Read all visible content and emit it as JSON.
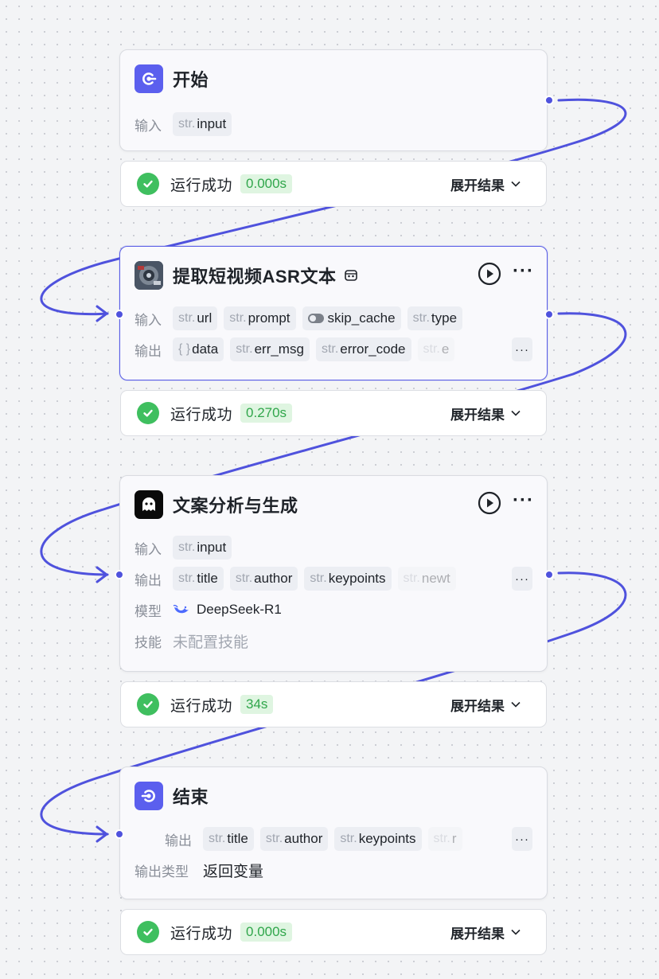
{
  "colors": {
    "edge": "#4f52dd",
    "accent": "#5b5fee",
    "success": "#3fbf5f"
  },
  "labels": {
    "input": "输入",
    "output": "输出",
    "model": "模型",
    "skill": "技能",
    "output_type": "输出类型",
    "type_prefix": "str.",
    "obj_prefix": "{ }"
  },
  "nodes": {
    "start": {
      "title": "开始",
      "icon": "start-icon",
      "inputs": [
        {
          "type": "str.",
          "name": "input"
        }
      ]
    },
    "asr": {
      "title": "提取短视频ASR文本",
      "icon": "plugin-thumbnail-icon",
      "inputs": [
        {
          "type": "str.",
          "name": "url"
        },
        {
          "type": "str.",
          "name": "prompt"
        },
        {
          "type": "toggle",
          "name": "skip_cache"
        },
        {
          "type": "str.",
          "name": "type"
        }
      ],
      "outputs": [
        {
          "type": "{ }",
          "name": "data"
        },
        {
          "type": "str.",
          "name": "err_msg"
        },
        {
          "type": "str.",
          "name": "error_code"
        },
        {
          "type": "str.",
          "name": "e"
        }
      ],
      "more": "···"
    },
    "llm": {
      "title": "文案分析与生成",
      "icon": "llm-bot-icon",
      "inputs": [
        {
          "type": "str.",
          "name": "input"
        }
      ],
      "outputs": [
        {
          "type": "str.",
          "name": "title"
        },
        {
          "type": "str.",
          "name": "author"
        },
        {
          "type": "str.",
          "name": "keypoints"
        },
        {
          "type": "str.",
          "name": "newt"
        }
      ],
      "model": "DeepSeek-R1",
      "skill": "未配置技能",
      "more": "···"
    },
    "end": {
      "title": "结束",
      "icon": "end-icon",
      "outputs": [
        {
          "type": "str.",
          "name": "title"
        },
        {
          "type": "str.",
          "name": "author"
        },
        {
          "type": "str.",
          "name": "keypoints"
        },
        {
          "type": "str.",
          "name": "r"
        }
      ],
      "output_type": "返回变量",
      "more": "···"
    }
  },
  "statuses": [
    {
      "text": "运行成功",
      "time": "0.000s",
      "expand": "展开结果"
    },
    {
      "text": "运行成功",
      "time": "0.270s",
      "expand": "展开结果"
    },
    {
      "text": "运行成功",
      "time": "34s",
      "expand": "展开结果"
    },
    {
      "text": "运行成功",
      "time": "0.000s",
      "expand": "展开结果"
    }
  ]
}
